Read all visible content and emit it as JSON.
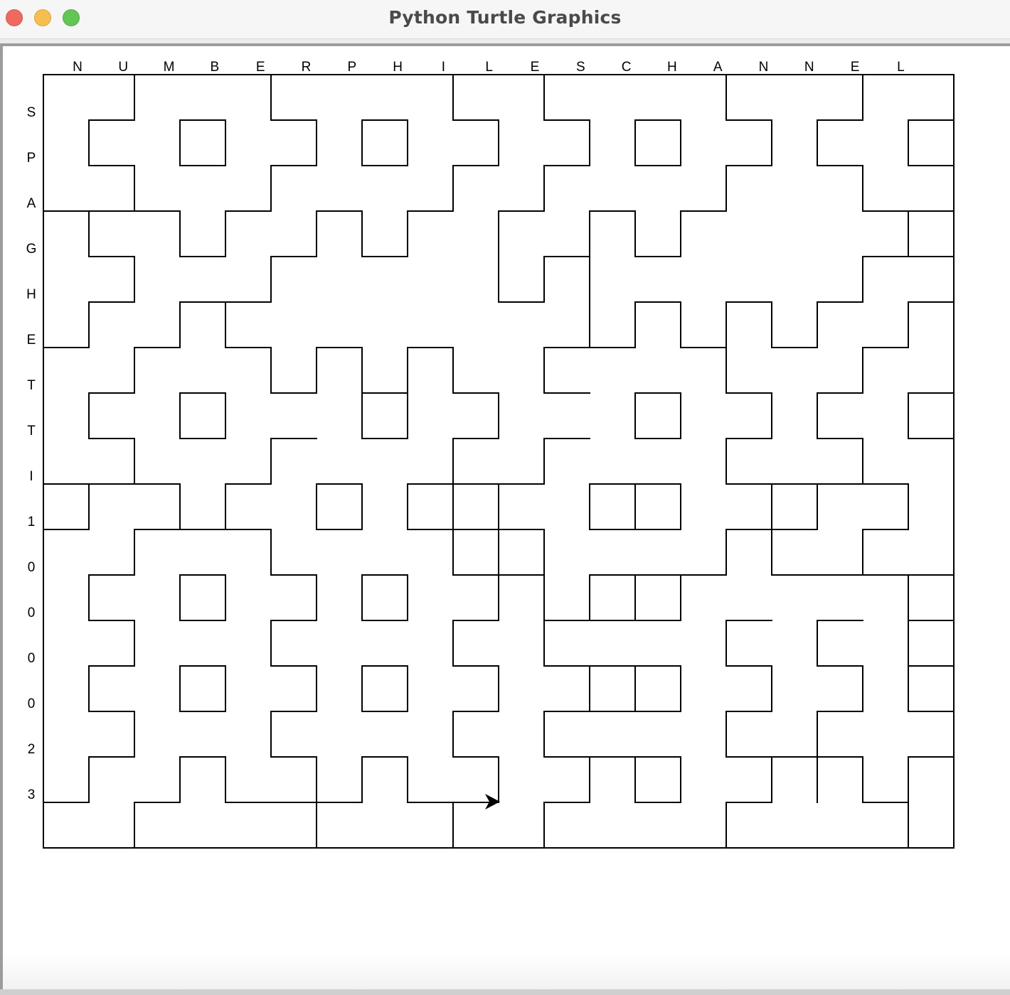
{
  "window": {
    "title": "Python Turtle Graphics",
    "buttons": [
      "close",
      "minimize",
      "zoom"
    ]
  },
  "canvas": {
    "top_labels": [
      "N",
      "U",
      "M",
      "B",
      "E",
      "R",
      "P",
      "H",
      "I",
      "L",
      "E",
      "S",
      "C",
      "H",
      "A",
      "N",
      "N",
      "E",
      "L"
    ],
    "side_labels": [
      "S",
      "P",
      "A",
      "G",
      "H",
      "E",
      "T",
      "T",
      "I",
      "1",
      "0",
      "0",
      "0",
      "0",
      "2",
      "3"
    ],
    "turtle_icon": "turtle-arrow-icon",
    "line_color": "#000000"
  }
}
